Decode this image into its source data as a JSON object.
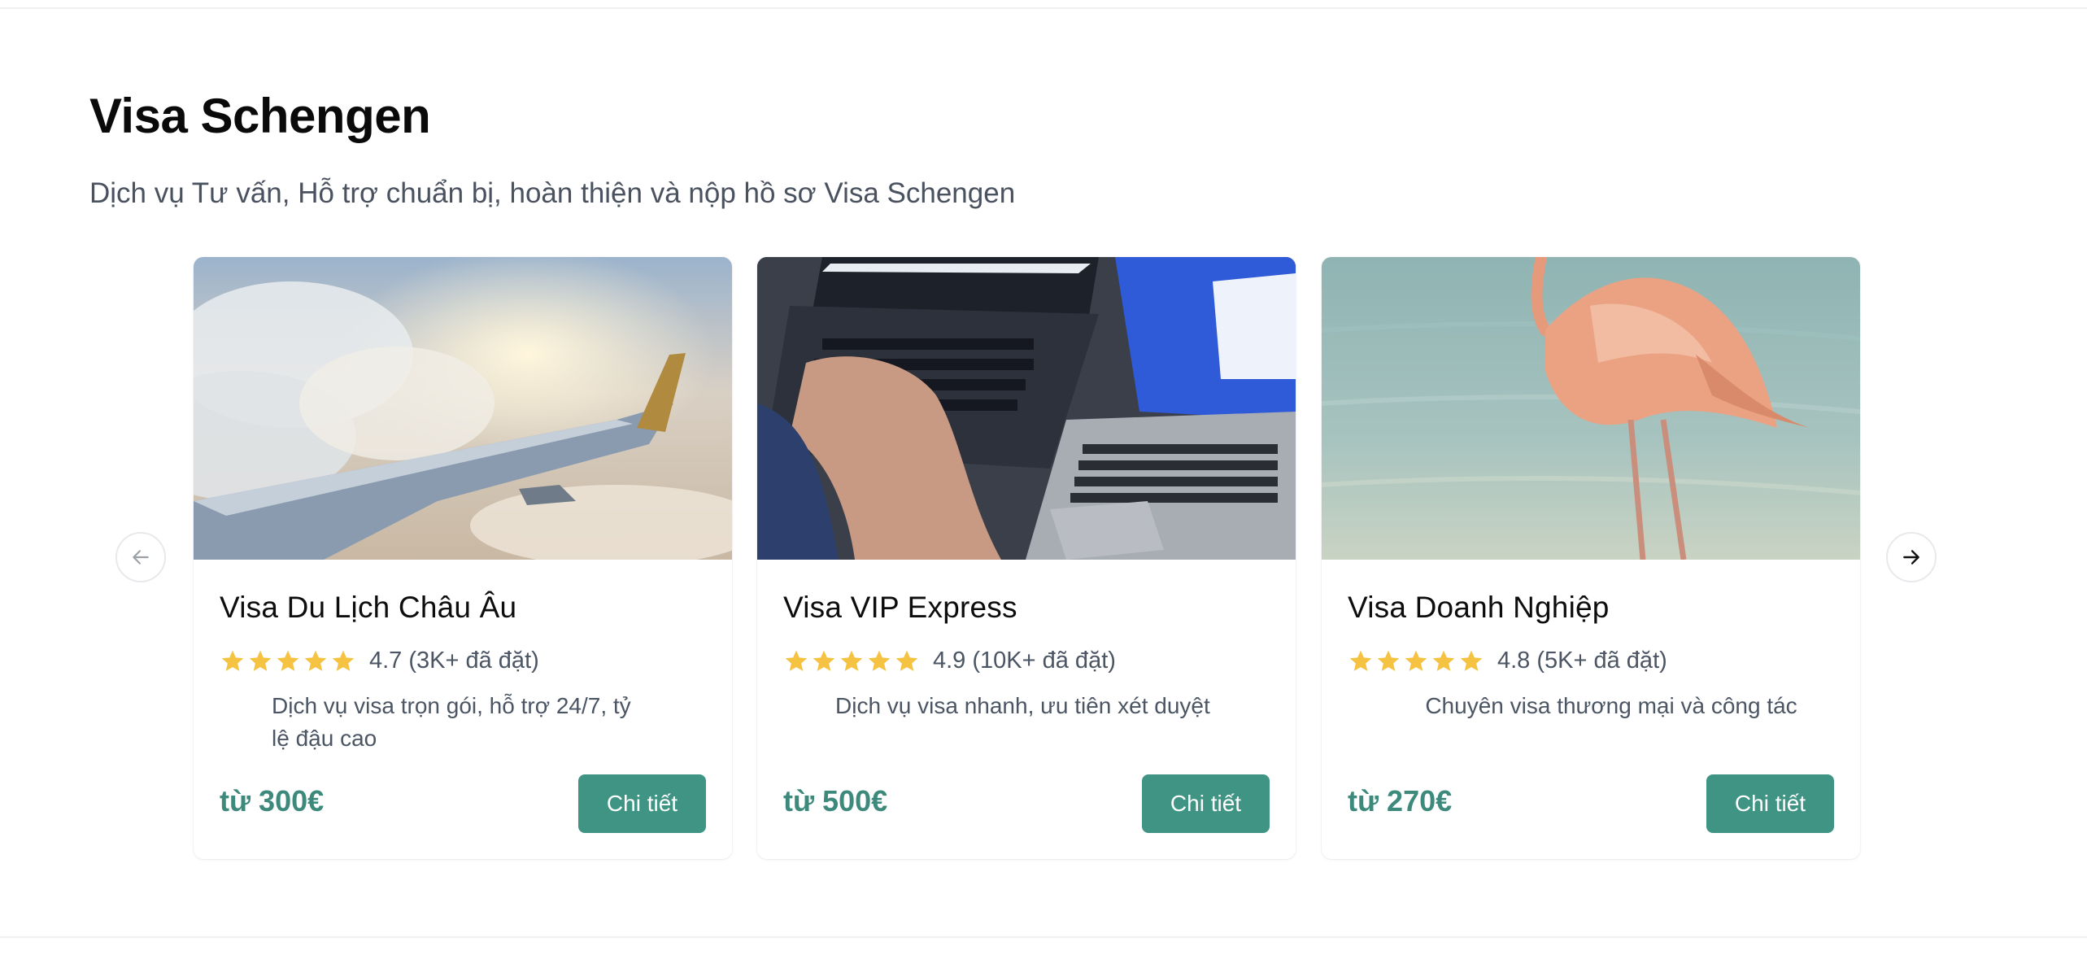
{
  "section": {
    "title": "Visa Schengen",
    "subtitle": "Dịch vụ Tư vấn, Hỗ trợ chuẩn bị, hoàn thiện và nộp hồ sơ Visa Schengen"
  },
  "carousel": {
    "prev_icon": "arrow-left-icon",
    "next_icon": "arrow-right-icon",
    "cards": [
      {
        "image": "airplane-wing-clouds",
        "title": "Visa Du Lịch Châu Âu",
        "rating": "4.7 (3K+ đã đặt)",
        "stars": 5,
        "description": "Dịch vụ visa trọn gói, hỗ trợ 24/7, tỷ lệ đậu cao",
        "price": "từ 300€",
        "button": "Chi tiết"
      },
      {
        "image": "hands-typing-laptops",
        "title": "Visa VIP Express",
        "rating": "4.9 (10K+ đã đặt)",
        "stars": 5,
        "description": "Dịch vụ visa nhanh, ưu tiên xét duyệt",
        "price": "từ 500€",
        "button": "Chi tiết"
      },
      {
        "image": "flamingo-water",
        "title": "Visa Doanh Nghiệp",
        "rating": "4.8 (5K+ đã đặt)",
        "stars": 5,
        "description": "Chuyên visa thương mại và công tác",
        "price": "từ 270€",
        "button": "Chi tiết"
      }
    ]
  },
  "colors": {
    "accent": "#3f9484",
    "price": "#3d8a7c",
    "star": "#f5c242",
    "muted_text": "#4b5563"
  }
}
